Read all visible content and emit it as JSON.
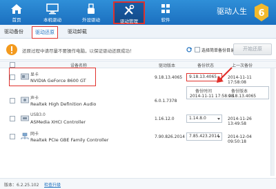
{
  "nav": {
    "items": [
      {
        "label": "首页",
        "icon": "home-icon"
      },
      {
        "label": "本机驱动",
        "icon": "monitor-icon"
      },
      {
        "label": "外设驱动",
        "icon": "usb-icon"
      },
      {
        "label": "驱动管理",
        "icon": "tools-icon"
      },
      {
        "label": "软件",
        "icon": "grid-icon"
      }
    ],
    "active": "驱动管理"
  },
  "brand": {
    "name": "驱动人生",
    "logo": "6"
  },
  "subtabs": [
    "驱动备份",
    "驱动还原",
    "驱动卸载"
  ],
  "subtab_active": "驱动还原",
  "warning": {
    "text": "还原过程中请尽量不要操作电脑，以保证驱动还原成功！",
    "checkbox_label": "选择简单备份目录",
    "start_button": "开始还原"
  },
  "table": {
    "headers": [
      "设备名称",
      "驱动版本",
      "备份状态",
      "上一次备份"
    ],
    "rows": [
      {
        "category": "显卡",
        "device": "NVIDIA GeForce 8600 GT",
        "version": "9.18.13.4065",
        "backup": "9.18.13.4065",
        "last_backup": "2014-11-11 17:58:08",
        "icon": "display-card-icon"
      },
      {
        "category": "声卡",
        "device": "Realtek High Definition Audio",
        "version": "6.0.1.7378",
        "backup": "",
        "last_backup": "",
        "icon": "sound-card-icon"
      },
      {
        "category": "USB3.0",
        "device": "ASMedia XHCI Controller",
        "version": "1.16.12.0",
        "backup": "1.14.8.0",
        "last_backup": "2014-11-26 13:49:58",
        "icon": "usb-controller-icon"
      },
      {
        "category": "网卡",
        "device": "Realtek PCIe GBE Family Controller",
        "version": "7.90.826.2014",
        "backup": "7.85.423.2014",
        "last_backup": "2014-12-04 09:50:18",
        "icon": "network-card-icon"
      }
    ]
  },
  "dropdown": {
    "header_time": "备份时间",
    "header_version": "备份版本",
    "time": "2014-11-11 17:58:08",
    "version": "9.18.13.4065"
  },
  "footer": {
    "version": "版本：6.2.25.102",
    "update_link": "检查升级"
  },
  "colors": {
    "titlebar": "#1b6fbf",
    "highlight": "#e0302b",
    "accent": "#1b6fbf"
  }
}
